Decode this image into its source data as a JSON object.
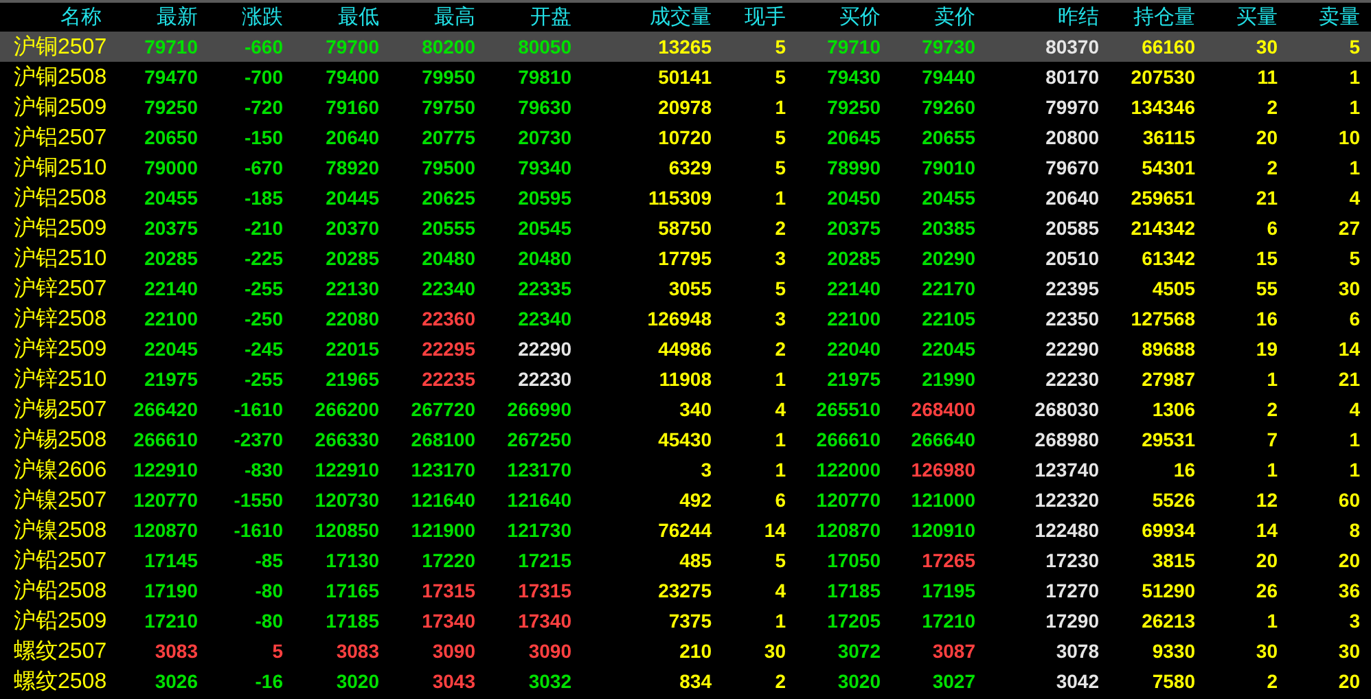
{
  "table": {
    "columns": [
      "名称",
      "最新",
      "涨跌",
      "最低",
      "最高",
      "开盘",
      "成交量",
      "现手",
      "买价",
      "卖价",
      "昨结",
      "持仓量",
      "买量",
      "卖量"
    ],
    "rows": [
      {
        "selected": true,
        "cells": [
          {
            "text": "沪铜2507"
          },
          {
            "text": "79710",
            "color": "#00e000"
          },
          {
            "text": "-660",
            "color": "#00e000"
          },
          {
            "text": "79700",
            "color": "#00e000"
          },
          {
            "text": "80200",
            "color": "#00e000"
          },
          {
            "text": "80050",
            "color": "#00e000"
          },
          {
            "text": "13265",
            "color": "#ffff00"
          },
          {
            "text": "5",
            "color": "#ffff00"
          },
          {
            "text": "79710",
            "color": "#00e000"
          },
          {
            "text": "79730",
            "color": "#00e000"
          },
          {
            "text": "80370",
            "color": "#e6e6e6"
          },
          {
            "text": "66160",
            "color": "#ffff00"
          },
          {
            "text": "30",
            "color": "#ffff00"
          },
          {
            "text": "5",
            "color": "#ffff00"
          }
        ]
      },
      {
        "selected": false,
        "cells": [
          {
            "text": "沪铜2508"
          },
          {
            "text": "79470",
            "color": "#00e000"
          },
          {
            "text": "-700",
            "color": "#00e000"
          },
          {
            "text": "79400",
            "color": "#00e000"
          },
          {
            "text": "79950",
            "color": "#00e000"
          },
          {
            "text": "79810",
            "color": "#00e000"
          },
          {
            "text": "50141",
            "color": "#ffff00"
          },
          {
            "text": "5",
            "color": "#ffff00"
          },
          {
            "text": "79430",
            "color": "#00e000"
          },
          {
            "text": "79440",
            "color": "#00e000"
          },
          {
            "text": "80170",
            "color": "#e6e6e6"
          },
          {
            "text": "207530",
            "color": "#ffff00"
          },
          {
            "text": "11",
            "color": "#ffff00"
          },
          {
            "text": "1",
            "color": "#ffff00"
          }
        ]
      },
      {
        "selected": false,
        "cells": [
          {
            "text": "沪铜2509"
          },
          {
            "text": "79250",
            "color": "#00e000"
          },
          {
            "text": "-720",
            "color": "#00e000"
          },
          {
            "text": "79160",
            "color": "#00e000"
          },
          {
            "text": "79750",
            "color": "#00e000"
          },
          {
            "text": "79630",
            "color": "#00e000"
          },
          {
            "text": "20978",
            "color": "#ffff00"
          },
          {
            "text": "1",
            "color": "#ffff00"
          },
          {
            "text": "79250",
            "color": "#00e000"
          },
          {
            "text": "79260",
            "color": "#00e000"
          },
          {
            "text": "79970",
            "color": "#e6e6e6"
          },
          {
            "text": "134346",
            "color": "#ffff00"
          },
          {
            "text": "2",
            "color": "#ffff00"
          },
          {
            "text": "1",
            "color": "#ffff00"
          }
        ]
      },
      {
        "selected": false,
        "cells": [
          {
            "text": "沪铝2507"
          },
          {
            "text": "20650",
            "color": "#00e000"
          },
          {
            "text": "-150",
            "color": "#00e000"
          },
          {
            "text": "20640",
            "color": "#00e000"
          },
          {
            "text": "20775",
            "color": "#00e000"
          },
          {
            "text": "20730",
            "color": "#00e000"
          },
          {
            "text": "10720",
            "color": "#ffff00"
          },
          {
            "text": "5",
            "color": "#ffff00"
          },
          {
            "text": "20645",
            "color": "#00e000"
          },
          {
            "text": "20655",
            "color": "#00e000"
          },
          {
            "text": "20800",
            "color": "#e6e6e6"
          },
          {
            "text": "36115",
            "color": "#ffff00"
          },
          {
            "text": "20",
            "color": "#ffff00"
          },
          {
            "text": "10",
            "color": "#ffff00"
          }
        ]
      },
      {
        "selected": false,
        "cells": [
          {
            "text": "沪铜2510"
          },
          {
            "text": "79000",
            "color": "#00e000"
          },
          {
            "text": "-670",
            "color": "#00e000"
          },
          {
            "text": "78920",
            "color": "#00e000"
          },
          {
            "text": "79500",
            "color": "#00e000"
          },
          {
            "text": "79340",
            "color": "#00e000"
          },
          {
            "text": "6329",
            "color": "#ffff00"
          },
          {
            "text": "5",
            "color": "#ffff00"
          },
          {
            "text": "78990",
            "color": "#00e000"
          },
          {
            "text": "79010",
            "color": "#00e000"
          },
          {
            "text": "79670",
            "color": "#e6e6e6"
          },
          {
            "text": "54301",
            "color": "#ffff00"
          },
          {
            "text": "2",
            "color": "#ffff00"
          },
          {
            "text": "1",
            "color": "#ffff00"
          }
        ]
      },
      {
        "selected": false,
        "cells": [
          {
            "text": "沪铝2508"
          },
          {
            "text": "20455",
            "color": "#00e000"
          },
          {
            "text": "-185",
            "color": "#00e000"
          },
          {
            "text": "20445",
            "color": "#00e000"
          },
          {
            "text": "20625",
            "color": "#00e000"
          },
          {
            "text": "20595",
            "color": "#00e000"
          },
          {
            "text": "115309",
            "color": "#ffff00"
          },
          {
            "text": "1",
            "color": "#ffff00"
          },
          {
            "text": "20450",
            "color": "#00e000"
          },
          {
            "text": "20455",
            "color": "#00e000"
          },
          {
            "text": "20640",
            "color": "#e6e6e6"
          },
          {
            "text": "259651",
            "color": "#ffff00"
          },
          {
            "text": "21",
            "color": "#ffff00"
          },
          {
            "text": "4",
            "color": "#ffff00"
          }
        ]
      },
      {
        "selected": false,
        "cells": [
          {
            "text": "沪铝2509"
          },
          {
            "text": "20375",
            "color": "#00e000"
          },
          {
            "text": "-210",
            "color": "#00e000"
          },
          {
            "text": "20370",
            "color": "#00e000"
          },
          {
            "text": "20555",
            "color": "#00e000"
          },
          {
            "text": "20545",
            "color": "#00e000"
          },
          {
            "text": "58750",
            "color": "#ffff00"
          },
          {
            "text": "2",
            "color": "#ffff00"
          },
          {
            "text": "20375",
            "color": "#00e000"
          },
          {
            "text": "20385",
            "color": "#00e000"
          },
          {
            "text": "20585",
            "color": "#e6e6e6"
          },
          {
            "text": "214342",
            "color": "#ffff00"
          },
          {
            "text": "6",
            "color": "#ffff00"
          },
          {
            "text": "27",
            "color": "#ffff00"
          }
        ]
      },
      {
        "selected": false,
        "cells": [
          {
            "text": "沪铝2510"
          },
          {
            "text": "20285",
            "color": "#00e000"
          },
          {
            "text": "-225",
            "color": "#00e000"
          },
          {
            "text": "20285",
            "color": "#00e000"
          },
          {
            "text": "20480",
            "color": "#00e000"
          },
          {
            "text": "20480",
            "color": "#00e000"
          },
          {
            "text": "17795",
            "color": "#ffff00"
          },
          {
            "text": "3",
            "color": "#ffff00"
          },
          {
            "text": "20285",
            "color": "#00e000"
          },
          {
            "text": "20290",
            "color": "#00e000"
          },
          {
            "text": "20510",
            "color": "#e6e6e6"
          },
          {
            "text": "61342",
            "color": "#ffff00"
          },
          {
            "text": "15",
            "color": "#ffff00"
          },
          {
            "text": "5",
            "color": "#ffff00"
          }
        ]
      },
      {
        "selected": false,
        "cells": [
          {
            "text": "沪锌2507"
          },
          {
            "text": "22140",
            "color": "#00e000"
          },
          {
            "text": "-255",
            "color": "#00e000"
          },
          {
            "text": "22130",
            "color": "#00e000"
          },
          {
            "text": "22340",
            "color": "#00e000"
          },
          {
            "text": "22335",
            "color": "#00e000"
          },
          {
            "text": "3055",
            "color": "#ffff00"
          },
          {
            "text": "5",
            "color": "#ffff00"
          },
          {
            "text": "22140",
            "color": "#00e000"
          },
          {
            "text": "22170",
            "color": "#00e000"
          },
          {
            "text": "22395",
            "color": "#e6e6e6"
          },
          {
            "text": "4505",
            "color": "#ffff00"
          },
          {
            "text": "55",
            "color": "#ffff00"
          },
          {
            "text": "30",
            "color": "#ffff00"
          }
        ]
      },
      {
        "selected": false,
        "cells": [
          {
            "text": "沪锌2508"
          },
          {
            "text": "22100",
            "color": "#00e000"
          },
          {
            "text": "-250",
            "color": "#00e000"
          },
          {
            "text": "22080",
            "color": "#00e000"
          },
          {
            "text": "22360",
            "color": "#ff4040"
          },
          {
            "text": "22340",
            "color": "#00e000"
          },
          {
            "text": "126948",
            "color": "#ffff00"
          },
          {
            "text": "3",
            "color": "#ffff00"
          },
          {
            "text": "22100",
            "color": "#00e000"
          },
          {
            "text": "22105",
            "color": "#00e000"
          },
          {
            "text": "22350",
            "color": "#e6e6e6"
          },
          {
            "text": "127568",
            "color": "#ffff00"
          },
          {
            "text": "16",
            "color": "#ffff00"
          },
          {
            "text": "6",
            "color": "#ffff00"
          }
        ]
      },
      {
        "selected": false,
        "cells": [
          {
            "text": "沪锌2509"
          },
          {
            "text": "22045",
            "color": "#00e000"
          },
          {
            "text": "-245",
            "color": "#00e000"
          },
          {
            "text": "22015",
            "color": "#00e000"
          },
          {
            "text": "22295",
            "color": "#ff4040"
          },
          {
            "text": "22290",
            "color": "#e6e6e6"
          },
          {
            "text": "44986",
            "color": "#ffff00"
          },
          {
            "text": "2",
            "color": "#ffff00"
          },
          {
            "text": "22040",
            "color": "#00e000"
          },
          {
            "text": "22045",
            "color": "#00e000"
          },
          {
            "text": "22290",
            "color": "#e6e6e6"
          },
          {
            "text": "89688",
            "color": "#ffff00"
          },
          {
            "text": "19",
            "color": "#ffff00"
          },
          {
            "text": "14",
            "color": "#ffff00"
          }
        ]
      },
      {
        "selected": false,
        "cells": [
          {
            "text": "沪锌2510"
          },
          {
            "text": "21975",
            "color": "#00e000"
          },
          {
            "text": "-255",
            "color": "#00e000"
          },
          {
            "text": "21965",
            "color": "#00e000"
          },
          {
            "text": "22235",
            "color": "#ff4040"
          },
          {
            "text": "22230",
            "color": "#e6e6e6"
          },
          {
            "text": "11908",
            "color": "#ffff00"
          },
          {
            "text": "1",
            "color": "#ffff00"
          },
          {
            "text": "21975",
            "color": "#00e000"
          },
          {
            "text": "21990",
            "color": "#00e000"
          },
          {
            "text": "22230",
            "color": "#e6e6e6"
          },
          {
            "text": "27987",
            "color": "#ffff00"
          },
          {
            "text": "1",
            "color": "#ffff00"
          },
          {
            "text": "21",
            "color": "#ffff00"
          }
        ]
      },
      {
        "selected": false,
        "cells": [
          {
            "text": "沪锡2507"
          },
          {
            "text": "266420",
            "color": "#00e000"
          },
          {
            "text": "-1610",
            "color": "#00e000"
          },
          {
            "text": "266200",
            "color": "#00e000"
          },
          {
            "text": "267720",
            "color": "#00e000"
          },
          {
            "text": "266990",
            "color": "#00e000"
          },
          {
            "text": "340",
            "color": "#ffff00"
          },
          {
            "text": "4",
            "color": "#ffff00"
          },
          {
            "text": "265510",
            "color": "#00e000"
          },
          {
            "text": "268400",
            "color": "#ff4040"
          },
          {
            "text": "268030",
            "color": "#e6e6e6"
          },
          {
            "text": "1306",
            "color": "#ffff00"
          },
          {
            "text": "2",
            "color": "#ffff00"
          },
          {
            "text": "4",
            "color": "#ffff00"
          }
        ]
      },
      {
        "selected": false,
        "cells": [
          {
            "text": "沪锡2508"
          },
          {
            "text": "266610",
            "color": "#00e000"
          },
          {
            "text": "-2370",
            "color": "#00e000"
          },
          {
            "text": "266330",
            "color": "#00e000"
          },
          {
            "text": "268100",
            "color": "#00e000"
          },
          {
            "text": "267250",
            "color": "#00e000"
          },
          {
            "text": "45430",
            "color": "#ffff00"
          },
          {
            "text": "1",
            "color": "#ffff00"
          },
          {
            "text": "266610",
            "color": "#00e000"
          },
          {
            "text": "266640",
            "color": "#00e000"
          },
          {
            "text": "268980",
            "color": "#e6e6e6"
          },
          {
            "text": "29531",
            "color": "#ffff00"
          },
          {
            "text": "7",
            "color": "#ffff00"
          },
          {
            "text": "1",
            "color": "#ffff00"
          }
        ]
      },
      {
        "selected": false,
        "cells": [
          {
            "text": "沪镍2606"
          },
          {
            "text": "122910",
            "color": "#00e000"
          },
          {
            "text": "-830",
            "color": "#00e000"
          },
          {
            "text": "122910",
            "color": "#00e000"
          },
          {
            "text": "123170",
            "color": "#00e000"
          },
          {
            "text": "123170",
            "color": "#00e000"
          },
          {
            "text": "3",
            "color": "#ffff00"
          },
          {
            "text": "1",
            "color": "#ffff00"
          },
          {
            "text": "122000",
            "color": "#00e000"
          },
          {
            "text": "126980",
            "color": "#ff4040"
          },
          {
            "text": "123740",
            "color": "#e6e6e6"
          },
          {
            "text": "16",
            "color": "#ffff00"
          },
          {
            "text": "1",
            "color": "#ffff00"
          },
          {
            "text": "1",
            "color": "#ffff00"
          }
        ]
      },
      {
        "selected": false,
        "cells": [
          {
            "text": "沪镍2507"
          },
          {
            "text": "120770",
            "color": "#00e000"
          },
          {
            "text": "-1550",
            "color": "#00e000"
          },
          {
            "text": "120730",
            "color": "#00e000"
          },
          {
            "text": "121640",
            "color": "#00e000"
          },
          {
            "text": "121640",
            "color": "#00e000"
          },
          {
            "text": "492",
            "color": "#ffff00"
          },
          {
            "text": "6",
            "color": "#ffff00"
          },
          {
            "text": "120770",
            "color": "#00e000"
          },
          {
            "text": "121000",
            "color": "#00e000"
          },
          {
            "text": "122320",
            "color": "#e6e6e6"
          },
          {
            "text": "5526",
            "color": "#ffff00"
          },
          {
            "text": "12",
            "color": "#ffff00"
          },
          {
            "text": "60",
            "color": "#ffff00"
          }
        ]
      },
      {
        "selected": false,
        "cells": [
          {
            "text": "沪镍2508"
          },
          {
            "text": "120870",
            "color": "#00e000"
          },
          {
            "text": "-1610",
            "color": "#00e000"
          },
          {
            "text": "120850",
            "color": "#00e000"
          },
          {
            "text": "121900",
            "color": "#00e000"
          },
          {
            "text": "121730",
            "color": "#00e000"
          },
          {
            "text": "76244",
            "color": "#ffff00"
          },
          {
            "text": "14",
            "color": "#ffff00"
          },
          {
            "text": "120870",
            "color": "#00e000"
          },
          {
            "text": "120910",
            "color": "#00e000"
          },
          {
            "text": "122480",
            "color": "#e6e6e6"
          },
          {
            "text": "69934",
            "color": "#ffff00"
          },
          {
            "text": "14",
            "color": "#ffff00"
          },
          {
            "text": "8",
            "color": "#ffff00"
          }
        ]
      },
      {
        "selected": false,
        "cells": [
          {
            "text": "沪铅2507"
          },
          {
            "text": "17145",
            "color": "#00e000"
          },
          {
            "text": "-85",
            "color": "#00e000"
          },
          {
            "text": "17130",
            "color": "#00e000"
          },
          {
            "text": "17220",
            "color": "#00e000"
          },
          {
            "text": "17215",
            "color": "#00e000"
          },
          {
            "text": "485",
            "color": "#ffff00"
          },
          {
            "text": "5",
            "color": "#ffff00"
          },
          {
            "text": "17050",
            "color": "#00e000"
          },
          {
            "text": "17265",
            "color": "#ff4040"
          },
          {
            "text": "17230",
            "color": "#e6e6e6"
          },
          {
            "text": "3815",
            "color": "#ffff00"
          },
          {
            "text": "20",
            "color": "#ffff00"
          },
          {
            "text": "20",
            "color": "#ffff00"
          }
        ]
      },
      {
        "selected": false,
        "cells": [
          {
            "text": "沪铅2508"
          },
          {
            "text": "17190",
            "color": "#00e000"
          },
          {
            "text": "-80",
            "color": "#00e000"
          },
          {
            "text": "17165",
            "color": "#00e000"
          },
          {
            "text": "17315",
            "color": "#ff4040"
          },
          {
            "text": "17315",
            "color": "#ff4040"
          },
          {
            "text": "23275",
            "color": "#ffff00"
          },
          {
            "text": "4",
            "color": "#ffff00"
          },
          {
            "text": "17185",
            "color": "#00e000"
          },
          {
            "text": "17195",
            "color": "#00e000"
          },
          {
            "text": "17270",
            "color": "#e6e6e6"
          },
          {
            "text": "51290",
            "color": "#ffff00"
          },
          {
            "text": "26",
            "color": "#ffff00"
          },
          {
            "text": "36",
            "color": "#ffff00"
          }
        ]
      },
      {
        "selected": false,
        "cells": [
          {
            "text": "沪铅2509"
          },
          {
            "text": "17210",
            "color": "#00e000"
          },
          {
            "text": "-80",
            "color": "#00e000"
          },
          {
            "text": "17185",
            "color": "#00e000"
          },
          {
            "text": "17340",
            "color": "#ff4040"
          },
          {
            "text": "17340",
            "color": "#ff4040"
          },
          {
            "text": "7375",
            "color": "#ffff00"
          },
          {
            "text": "1",
            "color": "#ffff00"
          },
          {
            "text": "17205",
            "color": "#00e000"
          },
          {
            "text": "17210",
            "color": "#00e000"
          },
          {
            "text": "17290",
            "color": "#e6e6e6"
          },
          {
            "text": "26213",
            "color": "#ffff00"
          },
          {
            "text": "1",
            "color": "#ffff00"
          },
          {
            "text": "3",
            "color": "#ffff00"
          }
        ]
      },
      {
        "selected": false,
        "cells": [
          {
            "text": "螺纹2507"
          },
          {
            "text": "3083",
            "color": "#ff4040"
          },
          {
            "text": "5",
            "color": "#ff4040"
          },
          {
            "text": "3083",
            "color": "#ff4040"
          },
          {
            "text": "3090",
            "color": "#ff4040"
          },
          {
            "text": "3090",
            "color": "#ff4040"
          },
          {
            "text": "210",
            "color": "#ffff00"
          },
          {
            "text": "30",
            "color": "#ffff00"
          },
          {
            "text": "3072",
            "color": "#00e000"
          },
          {
            "text": "3087",
            "color": "#ff4040"
          },
          {
            "text": "3078",
            "color": "#e6e6e6"
          },
          {
            "text": "9330",
            "color": "#ffff00"
          },
          {
            "text": "30",
            "color": "#ffff00"
          },
          {
            "text": "30",
            "color": "#ffff00"
          }
        ]
      },
      {
        "selected": false,
        "cells": [
          {
            "text": "螺纹2508"
          },
          {
            "text": "3026",
            "color": "#00e000"
          },
          {
            "text": "-16",
            "color": "#00e000"
          },
          {
            "text": "3020",
            "color": "#00e000"
          },
          {
            "text": "3043",
            "color": "#ff4040"
          },
          {
            "text": "3032",
            "color": "#00e000"
          },
          {
            "text": "834",
            "color": "#ffff00"
          },
          {
            "text": "2",
            "color": "#ffff00"
          },
          {
            "text": "3020",
            "color": "#00e000"
          },
          {
            "text": "3027",
            "color": "#00e000"
          },
          {
            "text": "3042",
            "color": "#e6e6e6"
          },
          {
            "text": "7580",
            "color": "#ffff00"
          },
          {
            "text": "2",
            "color": "#ffff00"
          },
          {
            "text": "20",
            "color": "#ffff00"
          }
        ]
      }
    ]
  }
}
